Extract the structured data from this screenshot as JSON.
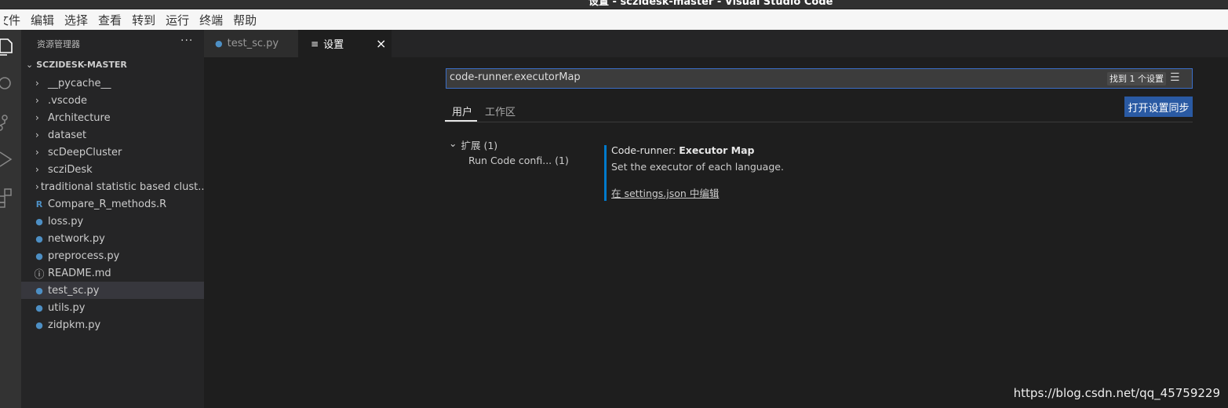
{
  "window": {
    "title": "设置 - sczidesk-master - Visual Studio Code"
  },
  "menu": [
    "文件",
    "编辑",
    "选择",
    "查看",
    "转到",
    "运行",
    "终端",
    "帮助"
  ],
  "sidebar": {
    "title": "资源管理器",
    "more": "···",
    "folder": "SCZIDESK-MASTER",
    "items": [
      {
        "label": "__pycache__",
        "type": "folder"
      },
      {
        "label": ".vscode",
        "type": "folder"
      },
      {
        "label": "Architecture",
        "type": "folder"
      },
      {
        "label": "dataset",
        "type": "folder"
      },
      {
        "label": "scDeepCluster",
        "type": "folder"
      },
      {
        "label": "scziDesk",
        "type": "folder"
      },
      {
        "label": "traditional statistic based clust...",
        "type": "folder"
      },
      {
        "label": "Compare_R_methods.R",
        "type": "r"
      },
      {
        "label": "loss.py",
        "type": "py"
      },
      {
        "label": "network.py",
        "type": "py"
      },
      {
        "label": "preprocess.py",
        "type": "py"
      },
      {
        "label": "README.md",
        "type": "info"
      },
      {
        "label": "test_sc.py",
        "type": "py",
        "selected": true
      },
      {
        "label": "utils.py",
        "type": "py"
      },
      {
        "label": "zidpkm.py",
        "type": "py"
      }
    ]
  },
  "tabs": [
    {
      "label": "test_sc.py",
      "icon": "python-icon"
    },
    {
      "label": "设置",
      "icon": "settings-editor-icon",
      "active": true,
      "close": "×"
    }
  ],
  "settings": {
    "search_value": "code-runner.executorMap",
    "found": "找到 1 个设置",
    "scope_tabs": [
      "用户",
      "工作区"
    ],
    "sync_button": "打开设置同步",
    "toc": [
      {
        "label": "扩展 (1)"
      },
      {
        "label": "Run Code confi... (1)"
      }
    ],
    "item": {
      "category": "Code-runner: ",
      "title": "Executor Map",
      "description": "Set the executor of each language.",
      "edit_link": "在 settings.json 中编辑"
    }
  },
  "watermark": "https://blog.csdn.net/qq_45759229",
  "colors": {
    "accent": "#007acc",
    "button": "#2a5aa3",
    "python": "#4d8fc4"
  }
}
